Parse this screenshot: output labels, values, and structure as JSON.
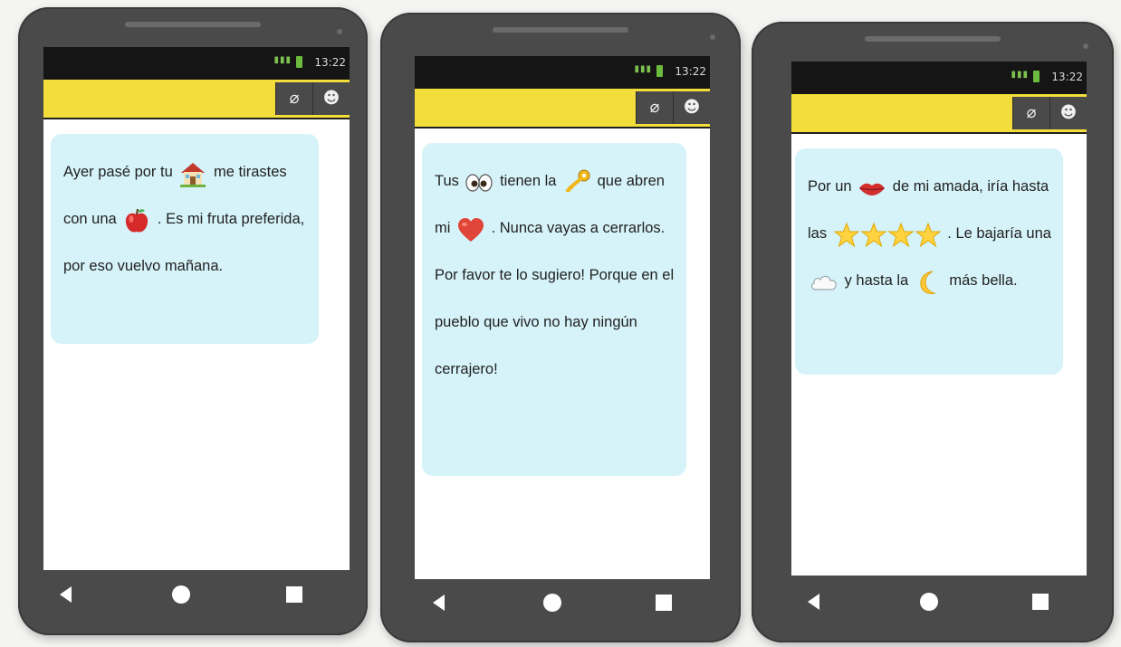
{
  "status_time": "13:22",
  "icons": {
    "attach": "paperclip-icon",
    "emoji": "smiley-icon",
    "back": "back-triangle-icon",
    "home": "home-circle-icon",
    "recent": "recent-square-icon"
  },
  "colors": {
    "toolbar": "#f2dd3a",
    "bubble": "#d6f3f9",
    "phone_body": "#4a4a4a",
    "status_bar": "#151515"
  },
  "phones": [
    {
      "message": [
        {
          "t": "Ayer pasé por tu "
        },
        {
          "emoji": "house"
        },
        {
          "t": " me tirastes con una "
        },
        {
          "emoji": "apple"
        },
        {
          "t": " . Es mi fruta preferida, por eso vuelvo mañana."
        }
      ]
    },
    {
      "message": [
        {
          "t": "Tus "
        },
        {
          "emoji": "eyes"
        },
        {
          "t": " tienen la "
        },
        {
          "emoji": "key"
        },
        {
          "t": " que abren mi "
        },
        {
          "emoji": "heart"
        },
        {
          "t": " . Nunca vayas a cerrarlos. Por favor te lo sugiero! Porque en el pueblo que vivo no hay ningún cerrajero!"
        }
      ]
    },
    {
      "message": [
        {
          "t": "Por un "
        },
        {
          "emoji": "lips"
        },
        {
          "t": " de mi amada, iría hasta las "
        },
        {
          "emoji": "stars"
        },
        {
          "t": " . Le bajaría una "
        },
        {
          "emoji": "cloud"
        },
        {
          "t": " y hasta la "
        },
        {
          "emoji": "moon"
        },
        {
          "t": " más bella."
        }
      ]
    }
  ]
}
